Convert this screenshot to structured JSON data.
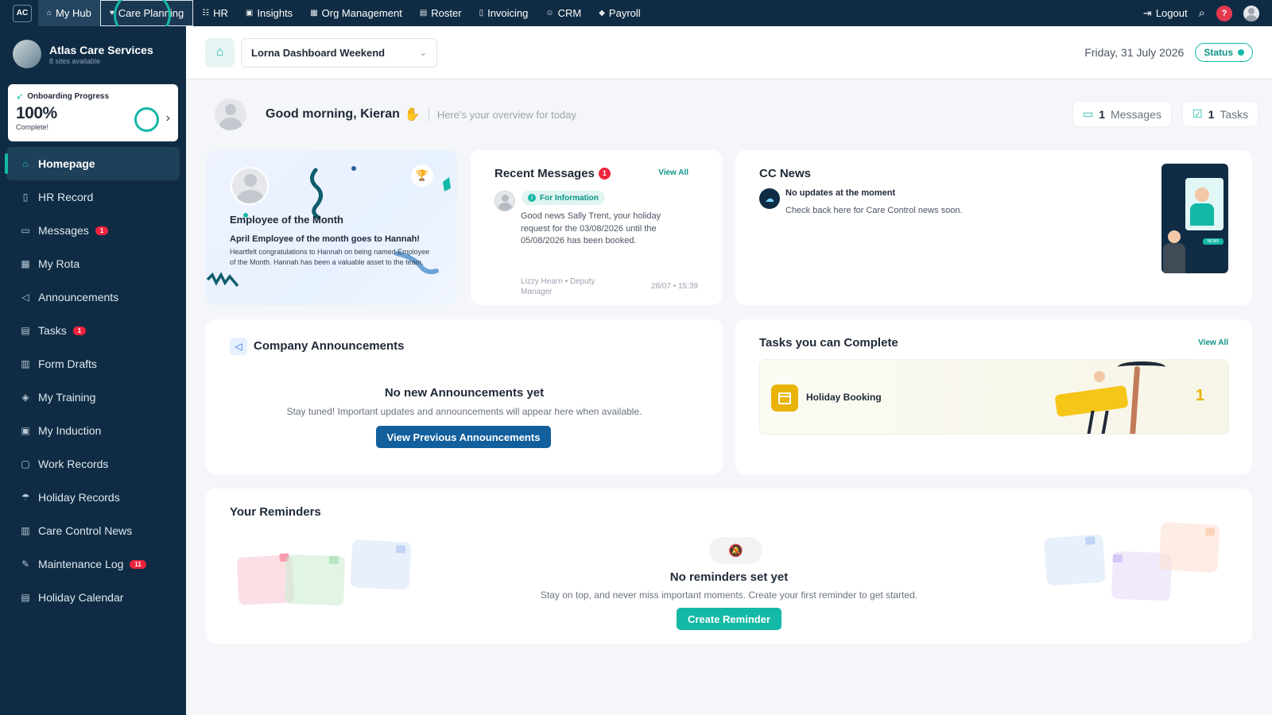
{
  "topnav": {
    "logo": "AC",
    "items": [
      {
        "label": "My Hub",
        "icon": "home-icon"
      },
      {
        "label": "Care Planning",
        "icon": "heart-icon"
      },
      {
        "label": "HR",
        "icon": "people-icon"
      },
      {
        "label": "Insights",
        "icon": "chart-icon"
      },
      {
        "label": "Org Management",
        "icon": "building-icon"
      },
      {
        "label": "Roster",
        "icon": "calendar-icon"
      },
      {
        "label": "Invoicing",
        "icon": "document-icon"
      },
      {
        "label": "CRM",
        "icon": "users-icon"
      },
      {
        "label": "Payroll",
        "icon": "tag-icon"
      }
    ],
    "logout_label": "Logout",
    "help_label": "?"
  },
  "sidebar": {
    "org_name": "Atlas Care Services",
    "org_sub": "8 sites available",
    "onboarding": {
      "title": "Onboarding Progress",
      "percent": "100%",
      "sub": "Complete!"
    },
    "items": [
      {
        "label": "Homepage",
        "icon": "home-icon",
        "active": true
      },
      {
        "label": "HR Record",
        "icon": "document-icon"
      },
      {
        "label": "Messages",
        "icon": "chat-icon",
        "badge": "1"
      },
      {
        "label": "My Rota",
        "icon": "grid-calendar-icon"
      },
      {
        "label": "Announcements",
        "icon": "megaphone-icon"
      },
      {
        "label": "Tasks",
        "icon": "calendar-icon",
        "badge": "1"
      },
      {
        "label": "Form Drafts",
        "icon": "clipboard-icon"
      },
      {
        "label": "My Training",
        "icon": "graduation-cap-icon"
      },
      {
        "label": "My Induction",
        "icon": "calendar-check-icon"
      },
      {
        "label": "Work Records",
        "icon": "briefcase-icon"
      },
      {
        "label": "Holiday Records",
        "icon": "umbrella-icon"
      },
      {
        "label": "Care Control News",
        "icon": "clipboard-icon"
      },
      {
        "label": "Maintenance Log",
        "icon": "wrench-icon",
        "badge": "11"
      },
      {
        "label": "Holiday Calendar",
        "icon": "calendar-icon"
      }
    ]
  },
  "header": {
    "dashboard_select": "Lorna Dashboard Weekend",
    "date": "Friday, 31 July 2026",
    "status_label": "Status"
  },
  "greeting": {
    "text": "Good morning, Kieran",
    "sub": "Here's your overview for today",
    "messages_count": "1",
    "messages_label": "Messages",
    "tasks_count": "1",
    "tasks_label": "Tasks"
  },
  "eotm": {
    "title": "Employee of the Month",
    "headline": "April Employee of the month goes to Hannah!",
    "body": "Heartfelt congratulations to Hannah on being named Employee of the Month. Hannah has been a valuable asset to the team."
  },
  "recent_messages": {
    "title": "Recent Messages",
    "badge": "1",
    "view_all": "View All",
    "tag": "For Information",
    "body": "Good news Sally Trent, your holiday request for the 03/08/2026 until the 05/08/2026 has been booked.",
    "from": "Lizzy Hearn • Deputy Manager",
    "time": "28/07 • 15:39"
  },
  "cc_news": {
    "title": "CC News",
    "heading": "No updates at the moment",
    "body": "Check back here for Care Control news soon.",
    "illustration_tag": "NEWS"
  },
  "announcements": {
    "title": "Company Announcements",
    "empty_heading": "No new Announcements yet",
    "empty_sub": "Stay tuned! Important updates and announcements will appear here when available.",
    "button": "View Previous Announcements"
  },
  "tasks_card": {
    "title": "Tasks you can Complete",
    "view_all": "View All",
    "task_label": "Holiday Booking",
    "task_count": "1"
  },
  "reminders": {
    "title": "Your Reminders",
    "empty_heading": "No reminders set yet",
    "empty_sub": "Stay on top, and never miss important moments. Create your first reminder to get started.",
    "button": "Create Reminder"
  },
  "colors": {
    "accent": "#14b8a6",
    "navy": "#0f2c44",
    "danger": "#ef233c",
    "announcement_button": "#125f9d"
  }
}
